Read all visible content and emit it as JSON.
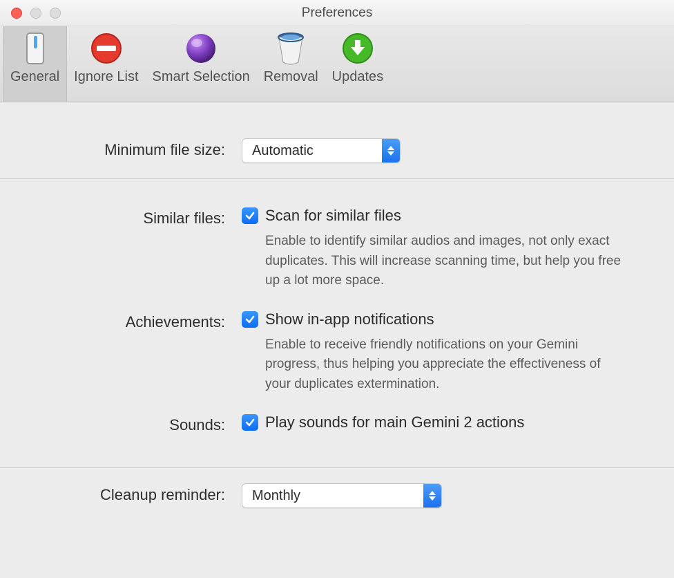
{
  "window": {
    "title": "Preferences"
  },
  "toolbar": {
    "tabs": [
      {
        "label": "General"
      },
      {
        "label": "Ignore List"
      },
      {
        "label": "Smart Selection"
      },
      {
        "label": "Removal"
      },
      {
        "label": "Updates"
      }
    ]
  },
  "general": {
    "min_file_size_label": "Minimum file size:",
    "min_file_size_value": "Automatic",
    "similar_label": "Similar files:",
    "similar_check_label": "Scan for similar files",
    "similar_desc": "Enable to identify similar audios and images, not only exact duplicates. This will increase scanning time, but help you free up a lot more space.",
    "achievements_label": "Achievements:",
    "achievements_check_label": "Show in-app notifications",
    "achievements_desc": "Enable to receive friendly notifications on your Gemini progress, thus helping you appreciate the effectiveness of your duplicates extermination.",
    "sounds_label": "Sounds:",
    "sounds_check_label": "Play sounds for main Gemini 2 actions",
    "cleanup_label": "Cleanup reminder:",
    "cleanup_value": "Monthly"
  }
}
